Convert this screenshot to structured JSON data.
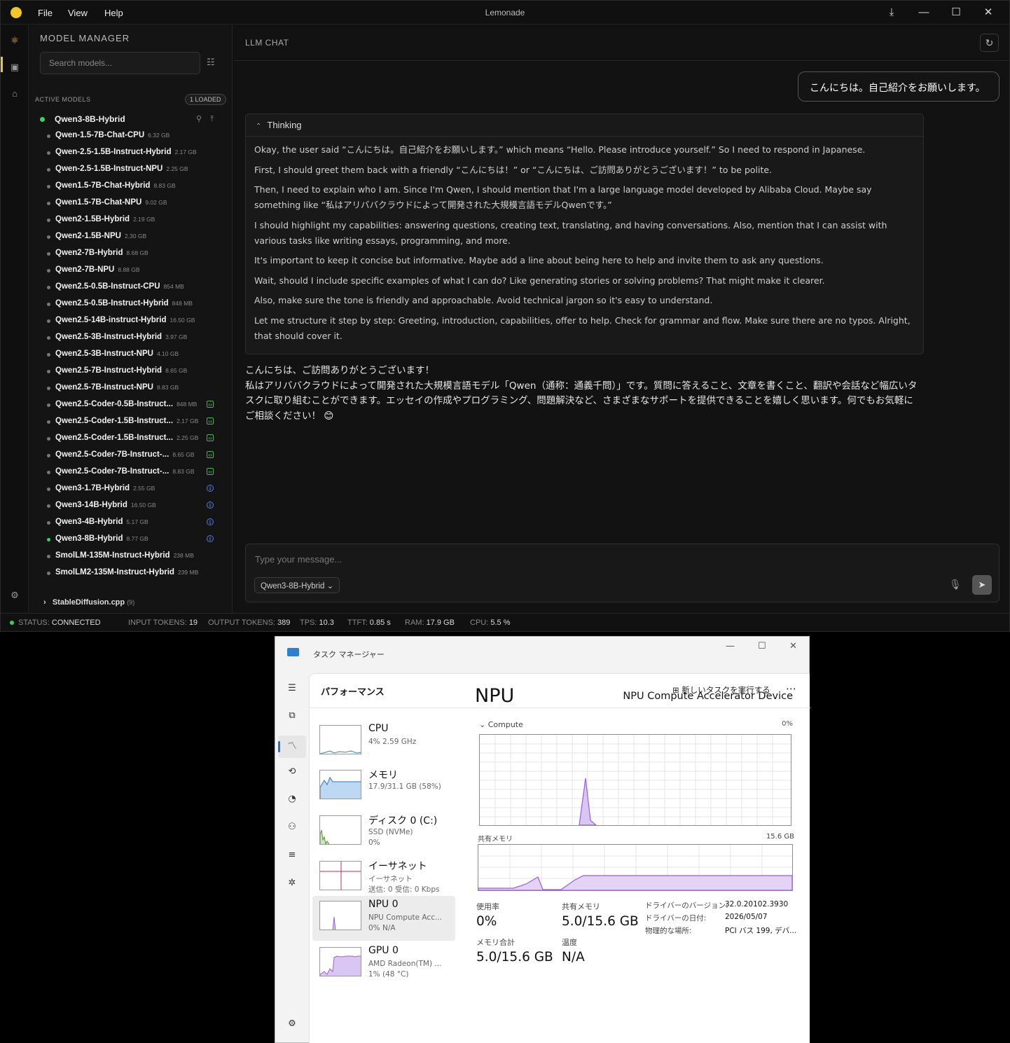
{
  "app": {
    "title": "Lemonade",
    "menus": [
      "File",
      "View",
      "Help"
    ]
  },
  "sidebar": {
    "title": "MODEL MANAGER",
    "search_placeholder": "Search models...",
    "active_label": "ACTIVE MODELS",
    "loaded_badge": "1 LOADED",
    "active_model": "Qwen3-8B-Hybrid",
    "models": [
      {
        "name": "Qwen-1.5-7B-Chat-CPU",
        "size": "6.32 GB",
        "tag": ""
      },
      {
        "name": "Qwen-2.5-1.5B-Instruct-Hybrid",
        "size": "2.17 GB",
        "tag": ""
      },
      {
        "name": "Qwen-2.5-1.5B-Instruct-NPU",
        "size": "2.25 GB",
        "tag": ""
      },
      {
        "name": "Qwen1.5-7B-Chat-Hybrid",
        "size": "8.83 GB",
        "tag": ""
      },
      {
        "name": "Qwen1.5-7B-Chat-NPU",
        "size": "9.02 GB",
        "tag": ""
      },
      {
        "name": "Qwen2-1.5B-Hybrid",
        "size": "2.19 GB",
        "tag": ""
      },
      {
        "name": "Qwen2-1.5B-NPU",
        "size": "2.30 GB",
        "tag": ""
      },
      {
        "name": "Qwen2-7B-Hybrid",
        "size": "8.68 GB",
        "tag": ""
      },
      {
        "name": "Qwen2-7B-NPU",
        "size": "8.88 GB",
        "tag": ""
      },
      {
        "name": "Qwen2.5-0.5B-Instruct-CPU",
        "size": "854 MB",
        "tag": ""
      },
      {
        "name": "Qwen2.5-0.5B-Instruct-Hybrid",
        "size": "848 MB",
        "tag": ""
      },
      {
        "name": "Qwen2.5-14B-instruct-Hybrid",
        "size": "16.50 GB",
        "tag": ""
      },
      {
        "name": "Qwen2.5-3B-Instruct-Hybrid",
        "size": "3.97 GB",
        "tag": ""
      },
      {
        "name": "Qwen2.5-3B-Instruct-NPU",
        "size": "4.10 GB",
        "tag": ""
      },
      {
        "name": "Qwen2.5-7B-Instruct-Hybrid",
        "size": "8.65 GB",
        "tag": ""
      },
      {
        "name": "Qwen2.5-7B-Instruct-NPU",
        "size": "8.83 GB",
        "tag": ""
      },
      {
        "name": "Qwen2.5-Coder-0.5B-Instruct...",
        "size": "848 MB",
        "tag": "code"
      },
      {
        "name": "Qwen2.5-Coder-1.5B-Instruct...",
        "size": "2.17 GB",
        "tag": "code"
      },
      {
        "name": "Qwen2.5-Coder-1.5B-Instruct...",
        "size": "2.25 GB",
        "tag": "code"
      },
      {
        "name": "Qwen2.5-Coder-7B-Instruct-...",
        "size": "8.65 GB",
        "tag": "code"
      },
      {
        "name": "Qwen2.5-Coder-7B-Instruct-...",
        "size": "8.83 GB",
        "tag": "code"
      },
      {
        "name": "Qwen3-1.7B-Hybrid",
        "size": "2.55 GB",
        "tag": "think"
      },
      {
        "name": "Qwen3-14B-Hybrid",
        "size": "16.50 GB",
        "tag": "think"
      },
      {
        "name": "Qwen3-4B-Hybrid",
        "size": "5.17 GB",
        "tag": "think"
      },
      {
        "name": "Qwen3-8B-Hybrid",
        "size": "8.77 GB",
        "tag": "think",
        "loaded": true
      },
      {
        "name": "SmolLM-135M-Instruct-Hybrid",
        "size": "238 MB",
        "tag": ""
      },
      {
        "name": "SmolLM2-135M-Instruct-Hybrid",
        "size": "239 MB",
        "tag": ""
      }
    ],
    "group": "StableDiffusion.cpp",
    "group_count": "(9)"
  },
  "chat": {
    "header": "LLM CHAT",
    "user_msg": "こんにちは。自己紹介をお願いします。",
    "thinking_label": "Thinking",
    "thinking": [
      "Okay, the user said “こんにちは。自己紹介をお願いします。” which means “Hello. Please introduce yourself.” So I need to respond in Japanese.",
      "First, I should greet them back with a friendly “こんにちは！” or “こんにちは、ご訪問ありがとうございます！” to be polite.",
      "Then, I need to explain who I am. Since I'm Qwen, I should mention that I'm a large language model developed by Alibaba Cloud. Maybe say something like “私はアリババクラウドによって開発された大規模言語モデルQwenです。”",
      "I should highlight my capabilities: answering questions, creating text, translating, and having conversations. Also, mention that I can assist with various tasks like writing essays, programming, and more.",
      "It's important to keep it concise but informative. Maybe add a line about being here to help and invite them to ask any questions.",
      "Wait, should I include specific examples of what I can do? Like generating stories or solving problems? That might make it clearer.",
      "Also, make sure the tone is friendly and approachable. Avoid technical jargon so it's easy to understand.",
      "Let me structure it step by step: Greeting, introduction, capabilities, offer to help. Check for grammar and flow. Make sure there are no typos. Alright, that should cover it."
    ],
    "answer_1": "こんにちは、ご訪問ありがとうございます！",
    "answer_2": "私はアリババクラウドによって開発された大規模言語モデル「Qwen（通称：通義千問）」です。質問に答えること、文章を書くこと、翻訳や会話など幅広いタスクに取り組むことができます。エッセイの作成やプログラミング、問題解決など、さまざまなサポートを提供できることを嬉しく思います。何でもお気軽にご相談ください！ 😊",
    "input_placeholder": "Type your message...",
    "model_select": "Qwen3-8B-Hybrid"
  },
  "status": {
    "status_k": "STATUS:",
    "status_v": "CONNECTED",
    "in_k": "INPUT TOKENS:",
    "in_v": "19",
    "out_k": "OUTPUT TOKENS:",
    "out_v": "389",
    "tps_k": "TPS:",
    "tps_v": "10.3",
    "ttft_k": "TTFT:",
    "ttft_v": "0.85 s",
    "ram_k": "RAM:",
    "ram_v": "17.9 GB",
    "cpu_k": "CPU:",
    "cpu_v": "5.5 %"
  },
  "taskmgr": {
    "title": "タスク マネージャー",
    "page": "パフォーマンス",
    "new_task": "新しいタスクを実行する",
    "devices": [
      {
        "name": "CPU",
        "s1": "4%  2.59 GHz",
        "s2": ""
      },
      {
        "name": "メモリ",
        "s1": "17.9/31.1 GB (58%)",
        "s2": ""
      },
      {
        "name": "ディスク 0 (C:)",
        "s1": "SSD (NVMe)",
        "s2": "0%"
      },
      {
        "name": "イーサネット",
        "s1": "イーサネット",
        "s2": "送信: 0 受信: 0 Kbps"
      },
      {
        "name": "NPU 0",
        "s1": "NPU Compute Acc...",
        "s2": "0%  N/A"
      },
      {
        "name": "GPU 0",
        "s1": "AMD Radeon(TM) ...",
        "s2": "1%  (48 °C)"
      }
    ],
    "detail": {
      "title": "NPU",
      "device": "NPU Compute Accelerator Device",
      "compute": "Compute",
      "compute_pct": "0%",
      "shared_mem": "共有メモリ",
      "shared_max": "15.6 GB",
      "usage_k": "使用率",
      "usage_v": "0%",
      "shared_k": "共有メモリ",
      "shared_v": "5.0/15.6 GB",
      "total_k": "メモリ合計",
      "total_v": "5.0/15.6 GB",
      "temp_k": "温度",
      "temp_v": "N/A",
      "drv_ver_k": "ドライバーのバージョン:",
      "drv_ver_v": "32.0.20102.3930",
      "drv_date_k": "ドライバーの日付:",
      "drv_date_v": "2026/05/07",
      "loc_k": "物理的な場所:",
      "loc_v": "PCI バス 199, デバ..."
    }
  }
}
